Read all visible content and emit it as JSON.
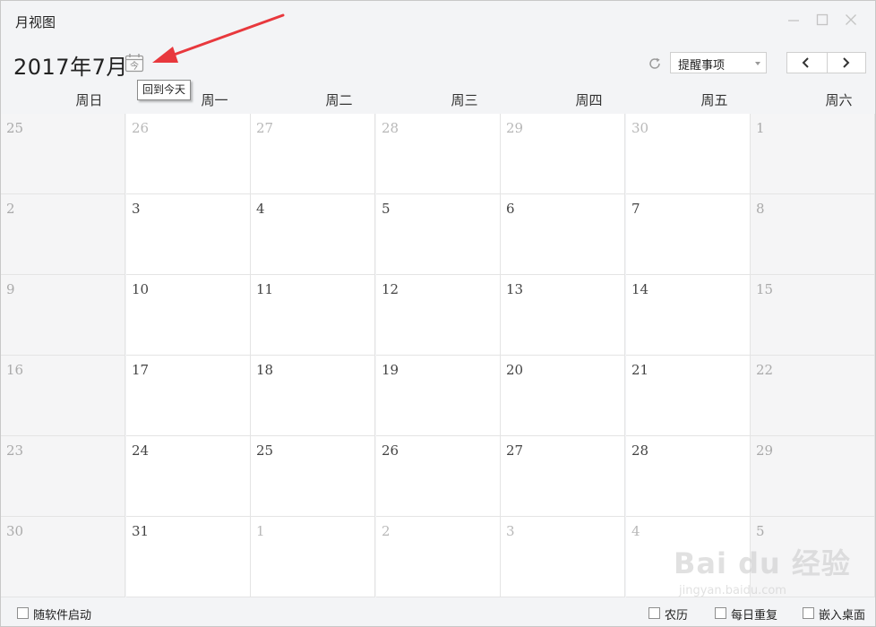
{
  "window": {
    "title": "月视图"
  },
  "header": {
    "month_title": "2017年7月",
    "today_tooltip": "回到今天",
    "today_icon_glyph": "今",
    "dropdown_value": "提醒事项"
  },
  "weekdays": [
    "周日",
    "周一",
    "周二",
    "周三",
    "周四",
    "周五",
    "周六"
  ],
  "calendar": {
    "weeks": [
      [
        {
          "d": "25",
          "o": true
        },
        {
          "d": "26",
          "o": true
        },
        {
          "d": "27",
          "o": true
        },
        {
          "d": "28",
          "o": true
        },
        {
          "d": "29",
          "o": true
        },
        {
          "d": "30",
          "o": true
        },
        {
          "d": "1",
          "o": false
        }
      ],
      [
        {
          "d": "2",
          "o": false
        },
        {
          "d": "3",
          "o": false
        },
        {
          "d": "4",
          "o": false
        },
        {
          "d": "5",
          "o": false
        },
        {
          "d": "6",
          "o": false
        },
        {
          "d": "7",
          "o": false
        },
        {
          "d": "8",
          "o": false
        }
      ],
      [
        {
          "d": "9",
          "o": false
        },
        {
          "d": "10",
          "o": false
        },
        {
          "d": "11",
          "o": false
        },
        {
          "d": "12",
          "o": false
        },
        {
          "d": "13",
          "o": false
        },
        {
          "d": "14",
          "o": false
        },
        {
          "d": "15",
          "o": false
        }
      ],
      [
        {
          "d": "16",
          "o": false
        },
        {
          "d": "17",
          "o": false
        },
        {
          "d": "18",
          "o": false
        },
        {
          "d": "19",
          "o": false
        },
        {
          "d": "20",
          "o": false
        },
        {
          "d": "21",
          "o": false
        },
        {
          "d": "22",
          "o": false
        }
      ],
      [
        {
          "d": "23",
          "o": false
        },
        {
          "d": "24",
          "o": false
        },
        {
          "d": "25",
          "o": false
        },
        {
          "d": "26",
          "o": false
        },
        {
          "d": "27",
          "o": false
        },
        {
          "d": "28",
          "o": false
        },
        {
          "d": "29",
          "o": false
        }
      ],
      [
        {
          "d": "30",
          "o": false
        },
        {
          "d": "31",
          "o": false
        },
        {
          "d": "1",
          "o": true
        },
        {
          "d": "2",
          "o": true
        },
        {
          "d": "3",
          "o": true
        },
        {
          "d": "4",
          "o": true
        },
        {
          "d": "5",
          "o": true
        }
      ]
    ]
  },
  "footer": {
    "start_with_app": "随软件启动",
    "lunar": "农历",
    "daily_repeat": "每日重复",
    "embed_desktop": "嵌入桌面"
  },
  "watermark": {
    "brand": "Bai du 经验",
    "url": "jingyan.baidu.com"
  },
  "colors": {
    "arrow": "#e8383d",
    "weekend_bg": "#f5f5f6",
    "other_month_text": "#b8b8b8"
  }
}
